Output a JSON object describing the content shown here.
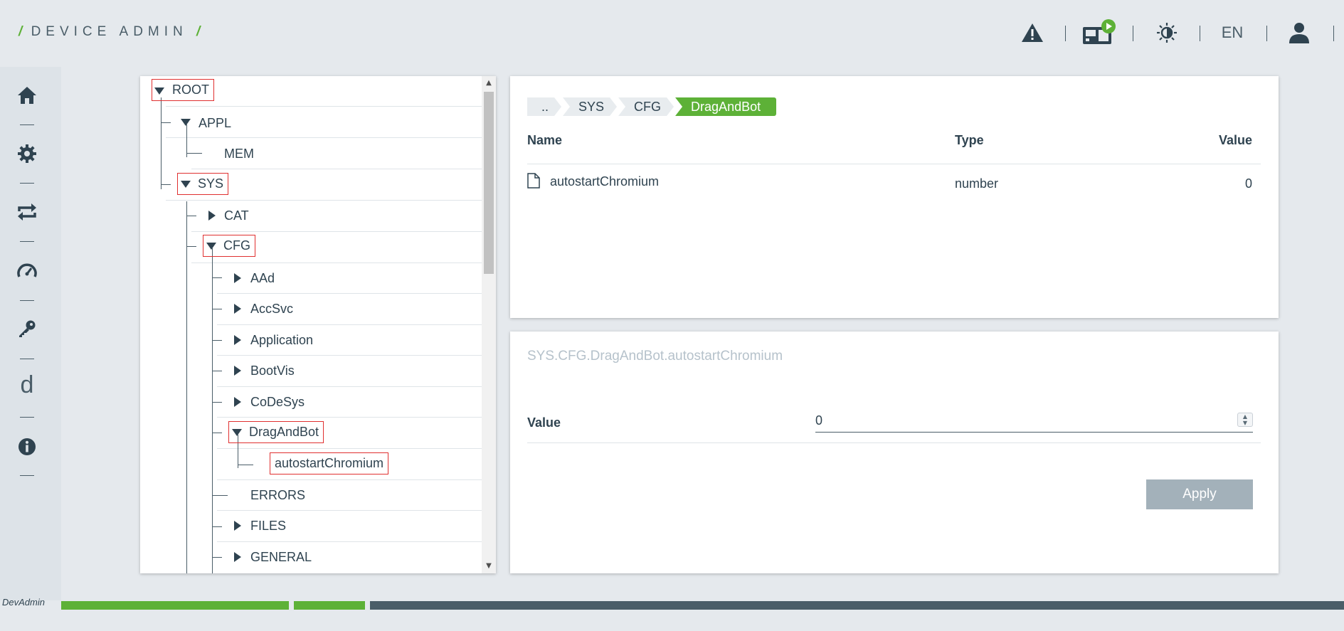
{
  "header": {
    "logo": "DEVICE ADMIN",
    "language": "EN",
    "icons": [
      "warning-icon",
      "device-run-icon",
      "theme-toggle-icon",
      "user-icon"
    ],
    "accent_color": "#5db137"
  },
  "sidenav": {
    "items": [
      "home-icon",
      "settings-icon",
      "sync-icon",
      "dashboard-icon",
      "key-icon",
      "d",
      "info-icon"
    ]
  },
  "tree": {
    "nodes": [
      {
        "label": "ROOT",
        "expanded": true
      },
      {
        "label": "APPL",
        "expanded": true
      },
      {
        "label": "MEM"
      },
      {
        "label": "SYS",
        "expanded": true
      },
      {
        "label": "CAT",
        "expanded": false
      },
      {
        "label": "CFG",
        "expanded": true
      },
      {
        "label": "AAd",
        "expanded": false
      },
      {
        "label": "AccSvc",
        "expanded": false
      },
      {
        "label": "Application",
        "expanded": false
      },
      {
        "label": "BootVis",
        "expanded": false
      },
      {
        "label": "CoDeSys",
        "expanded": false
      },
      {
        "label": "DragAndBot",
        "expanded": true
      },
      {
        "label": "autostartChromium"
      },
      {
        "label": "ERRORS"
      },
      {
        "label": "FILES",
        "expanded": false
      },
      {
        "label": "GENERAL",
        "expanded": false
      }
    ]
  },
  "browser": {
    "breadcrumb": [
      "..",
      "SYS",
      "CFG",
      "DragAndBot"
    ],
    "columns": {
      "name": "Name",
      "type": "Type",
      "value": "Value"
    },
    "rows": [
      {
        "name": "autostartChromium",
        "type": "number",
        "value": "0"
      }
    ]
  },
  "detail": {
    "path": "SYS.CFG.DragAndBot.autostartChromium",
    "field_label": "Value",
    "field_value": "0",
    "apply_label": "Apply"
  },
  "footer": {
    "label": "DevAdmin"
  }
}
